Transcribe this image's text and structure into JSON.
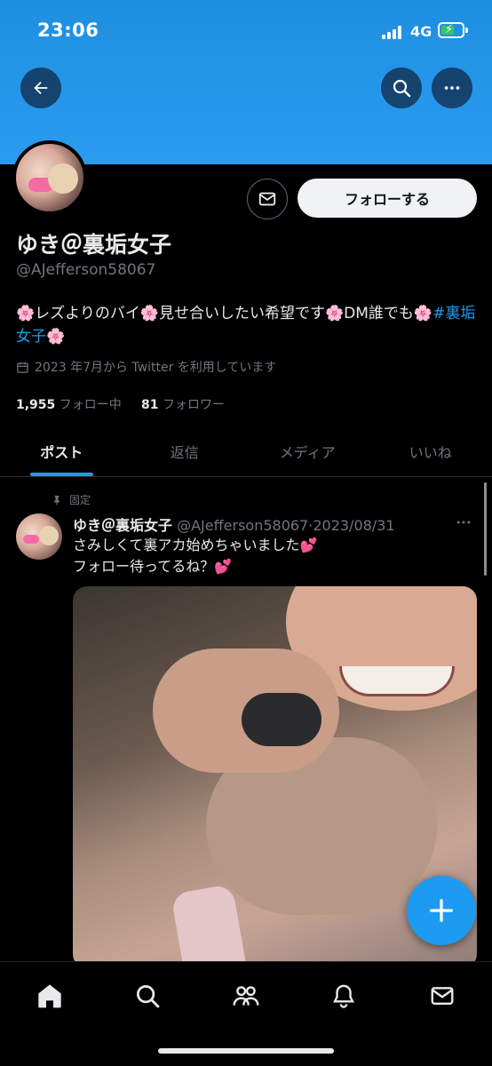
{
  "status": {
    "time": "23:06",
    "network": "4G"
  },
  "header": {
    "back_icon": "arrow-left-icon",
    "search_icon": "search-icon",
    "more_icon": "more-horizontal-icon"
  },
  "profile": {
    "display_name": "ゆき＠裏垢女子",
    "handle": "@AJefferson58067",
    "bio_text": "🌸レズよりのバイ🌸見せ合いしたい希望です🌸DM誰でも🌸",
    "bio_hashtag": "#裏垢女子",
    "bio_end": "🌸",
    "joined": "2023 年7月から Twitter を利用しています",
    "following_count": "1,955",
    "following_label": "フォロー中",
    "followers_count": "81",
    "followers_label": "フォロワー",
    "follow_button": "フォローする"
  },
  "tabs": [
    {
      "label": "ポスト",
      "active": true
    },
    {
      "label": "返信",
      "active": false
    },
    {
      "label": "メディア",
      "active": false
    },
    {
      "label": "いいね",
      "active": false
    }
  ],
  "post": {
    "pinned_label": "固定",
    "name": "ゆき＠裏垢女子",
    "handle": "@AJefferson58067",
    "date": "2023/08/31",
    "line1": "さみしくて裏アカ始めちゃいました💕",
    "line2": "フォロー待ってるね？💕"
  },
  "colors": {
    "accent": "#1d9bf0",
    "banner": "#2b9bf0"
  }
}
